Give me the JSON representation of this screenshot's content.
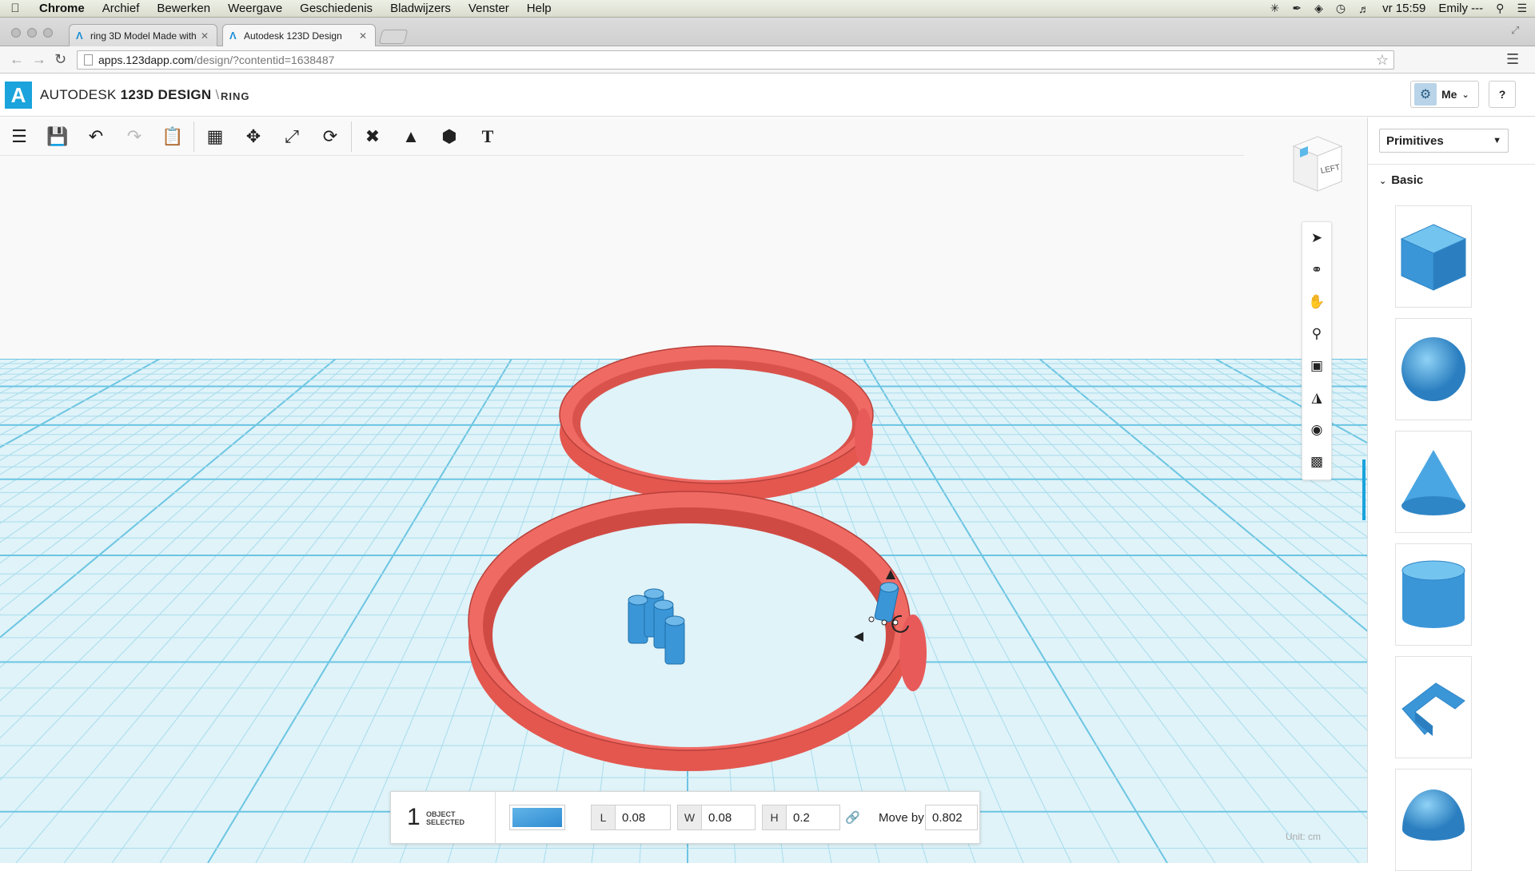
{
  "menubar": {
    "app": "Chrome",
    "items": [
      "Archief",
      "Bewerken",
      "Weergave",
      "Geschiedenis",
      "Bladwijzers",
      "Venster",
      "Help"
    ],
    "clock": "vr 15:59",
    "user": "Emily ---"
  },
  "tabs": [
    {
      "title": "ring 3D Model Made with",
      "active": false
    },
    {
      "title": "Autodesk 123D Design",
      "active": true
    }
  ],
  "address": {
    "host": "apps.123dapp.com",
    "path": "/design/?contentid=1638487"
  },
  "app": {
    "brand_prefix": "AUTODESK",
    "brand_name": "123D DESIGN",
    "separator": "\\",
    "doc_name": "RING",
    "user_button": "Me",
    "help_button": "?"
  },
  "toolbar": {
    "icons": [
      "menu-icon",
      "save-icon",
      "undo-icon",
      "redo-icon",
      "clipboard-icon",
      "sketch-icon",
      "move-icon",
      "scale-icon",
      "refresh-icon",
      "modify-icon",
      "combine-icon",
      "group-icon",
      "text-icon"
    ]
  },
  "viewcube": {
    "face_label": "LEFT"
  },
  "nav_icons": [
    "select-arrow-icon",
    "orbit-icon",
    "pan-hand-icon",
    "zoom-icon",
    "fit-view-icon",
    "zoom-selected-icon",
    "visibility-eye-icon",
    "material-icon"
  ],
  "selection": {
    "count": "1",
    "label_line1": "OBJECT",
    "label_line2": "SELECTED",
    "color": "#3b96d8",
    "L_label": "L",
    "L": "0.08",
    "W_label": "W",
    "W": "0.08",
    "H_label": "H",
    "H": "0.2",
    "move_label": "Move by",
    "move_value": "0.802"
  },
  "units": "Unit:  cm",
  "panel": {
    "dropdown": "Primitives",
    "section": "Basic",
    "primitives": [
      "box",
      "sphere",
      "cone",
      "cylinder",
      "polyline",
      "hemisphere"
    ]
  },
  "colors": {
    "accent": "#1aa3dc",
    "ring": "#e85a5a",
    "object_blue": "#3b96d8",
    "grid": "#bfe6f1"
  }
}
